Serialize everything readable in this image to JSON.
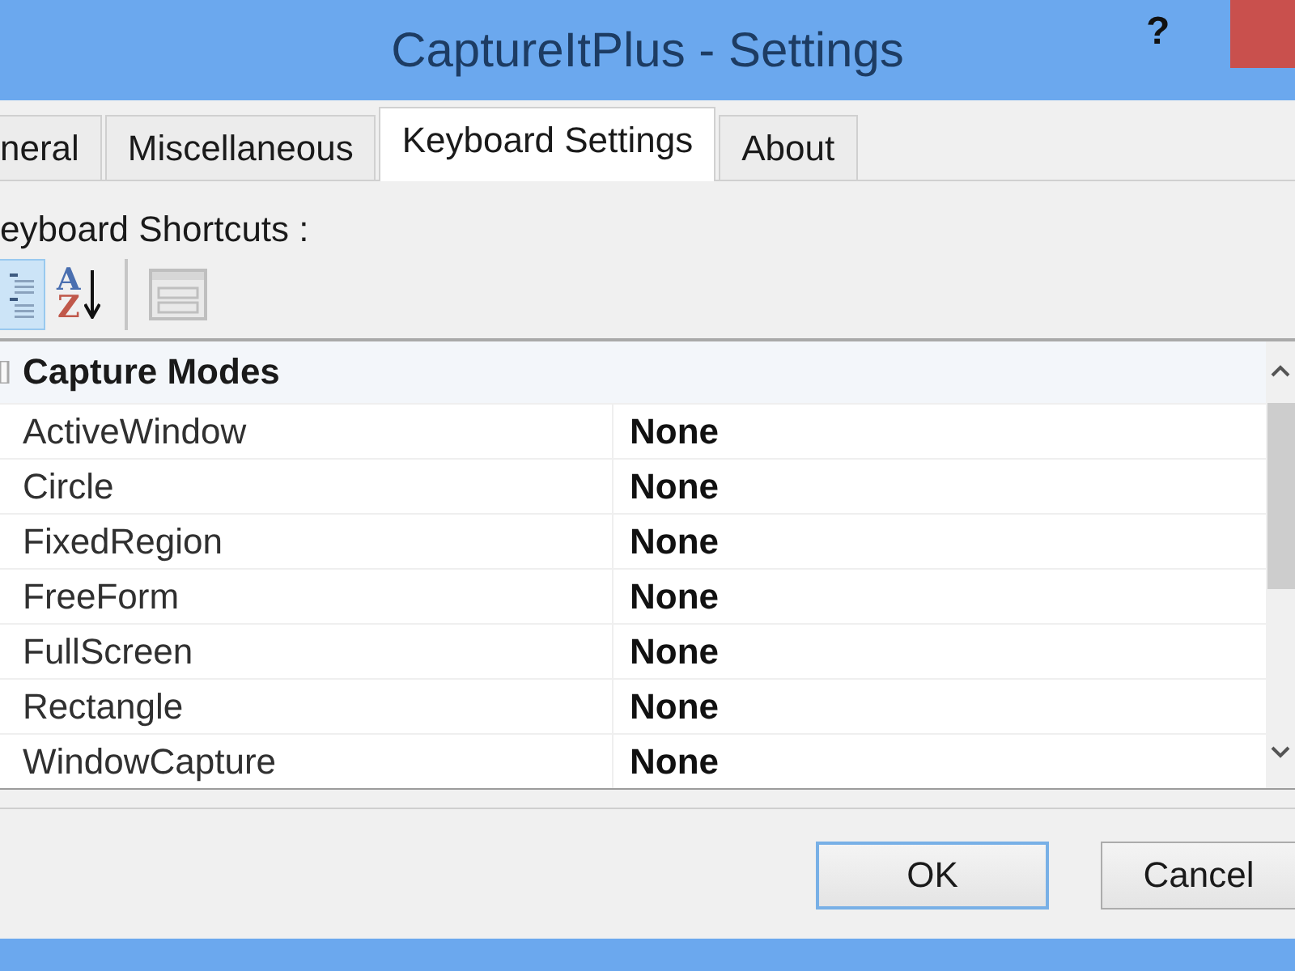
{
  "window": {
    "title": "CaptureItPlus - Settings",
    "help_button": "?"
  },
  "tabs": [
    {
      "label": "neral",
      "selected": false
    },
    {
      "label": "Miscellaneous",
      "selected": false
    },
    {
      "label": "Keyboard Settings",
      "selected": true
    },
    {
      "label": "About",
      "selected": false
    }
  ],
  "section_label": "eyboard Shortcuts :",
  "toolbar": {
    "sort_buttons": [
      {
        "kind": "categorized",
        "selected": true
      },
      {
        "kind": "alphabetical",
        "selected": false,
        "letters": [
          "A",
          "Z"
        ]
      }
    ],
    "property_pages_button": {
      "disabled": true
    }
  },
  "property_grid": {
    "categories": [
      {
        "name": "Capture Modes",
        "properties": [
          {
            "name": "ActiveWindow",
            "value": "None"
          },
          {
            "name": "Circle",
            "value": "None"
          },
          {
            "name": "FixedRegion",
            "value": "None"
          },
          {
            "name": "FreeForm",
            "value": "None"
          },
          {
            "name": "FullScreen",
            "value": "None"
          },
          {
            "name": "Rectangle",
            "value": "None"
          },
          {
            "name": "WindowCapture",
            "value": "None"
          }
        ]
      }
    ]
  },
  "buttons": [
    {
      "label": "OK",
      "default": true
    },
    {
      "label": "Cancel",
      "default": false
    }
  ]
}
